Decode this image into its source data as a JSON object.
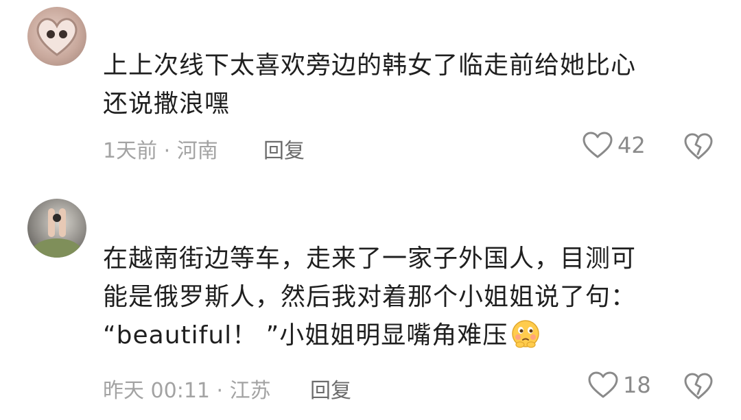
{
  "comments": [
    {
      "avatar": "hands-heart-avatar",
      "lines": [
        "上上次线下太喜欢旁边的韩女了临走前给她比心",
        "还说撒浪嘿"
      ],
      "meta": "1天前 · 河南",
      "reply_label": "回复",
      "like_count": "42",
      "like_icon": "heart-outline-icon",
      "dislike_icon": "broken-heart-icon"
    },
    {
      "avatar": "photo-avatar",
      "lines": [
        "在越南街边等车，走来了一家子外国人，目测可",
        "能是俄罗斯人，然后我对着那个小姐姐说了句：",
        "“beautiful！ ”小姐姐明显嘴角难压"
      ],
      "emoji": "blush-face-emoji",
      "meta": "昨天 00:11 · 江苏",
      "reply_label": "回复",
      "like_count": "18",
      "like_icon": "heart-outline-icon",
      "dislike_icon": "broken-heart-icon"
    }
  ],
  "colors": {
    "text": "#1f1f1f",
    "meta": "#a3a3a3",
    "reply": "#6b6b6b",
    "icon": "#8a8a8a"
  }
}
